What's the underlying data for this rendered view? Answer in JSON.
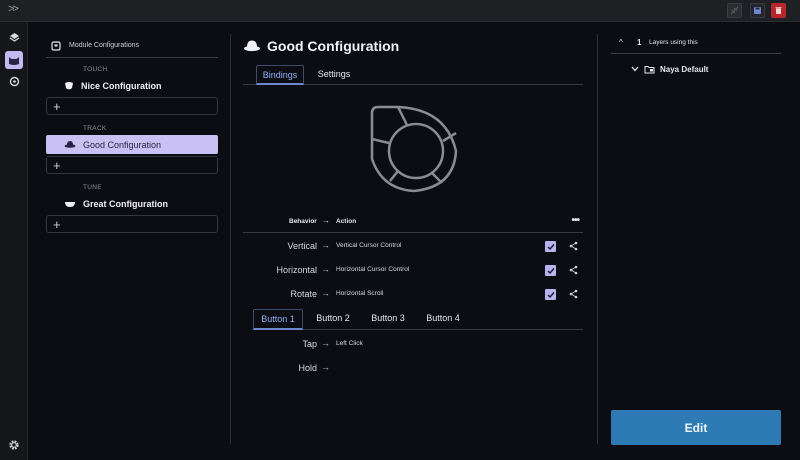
{
  "topbar": {
    "expand_icon": "double-chevron-right-icon",
    "buttons": [
      "disabled-link-icon",
      "save-icon",
      "trash-icon"
    ]
  },
  "sidebar": {
    "icons": [
      "layers-icon",
      "cat-face-icon",
      "refresh-icon"
    ],
    "bottom_icon": "gear-icon"
  },
  "modules": {
    "header": "Module Configurations",
    "groups": [
      {
        "label": "TOUCH",
        "configs": [
          {
            "name": "Nice Configuration",
            "icon": "touch-module-icon"
          }
        ],
        "add_label": "+"
      },
      {
        "label": "TRACK",
        "configs": [
          {
            "name": "Good Configuration",
            "icon": "track-module-icon",
            "selected": true
          }
        ],
        "add_label": "+"
      },
      {
        "label": "TUNE",
        "configs": [
          {
            "name": "Great Configuration",
            "icon": "tune-module-icon"
          }
        ],
        "add_label": "+"
      }
    ]
  },
  "main": {
    "title": "Good Configuration",
    "tabs": [
      {
        "label": "Bindings",
        "active": true
      },
      {
        "label": "Settings",
        "active": false
      }
    ],
    "behavior_header": {
      "behavior": "Behavior",
      "arrow": "→",
      "action": "Action",
      "more": "•••"
    },
    "mappings": [
      {
        "behavior": "Vertical",
        "arrow": "→",
        "action": "Vertical Cursor Control",
        "checked": true
      },
      {
        "behavior": "Horizontal",
        "arrow": "→",
        "action": "Horizontal Cursor Control",
        "checked": true
      },
      {
        "behavior": "Rotate",
        "arrow": "→",
        "action": "Horizontal Scroll",
        "checked": true
      }
    ],
    "button_tabs": [
      {
        "label": "Button 1",
        "active": true
      },
      {
        "label": "Button 2",
        "active": false
      },
      {
        "label": "Button 3",
        "active": false
      },
      {
        "label": "Button 4",
        "active": false
      }
    ],
    "button_mappings": [
      {
        "behavior": "Tap",
        "arrow": "→",
        "action": "Left Click"
      },
      {
        "behavior": "Hold",
        "arrow": "→",
        "action": ""
      }
    ]
  },
  "layers": {
    "count": "1",
    "label": "Layers using this",
    "items": [
      {
        "name": "Naya Default"
      }
    ]
  },
  "edit_button": "Edit",
  "colors": {
    "accent_selected": "#c9c0f4",
    "tab_active": "#8fb0f5",
    "edit": "#2e7ab4",
    "delete": "#b8262c"
  }
}
